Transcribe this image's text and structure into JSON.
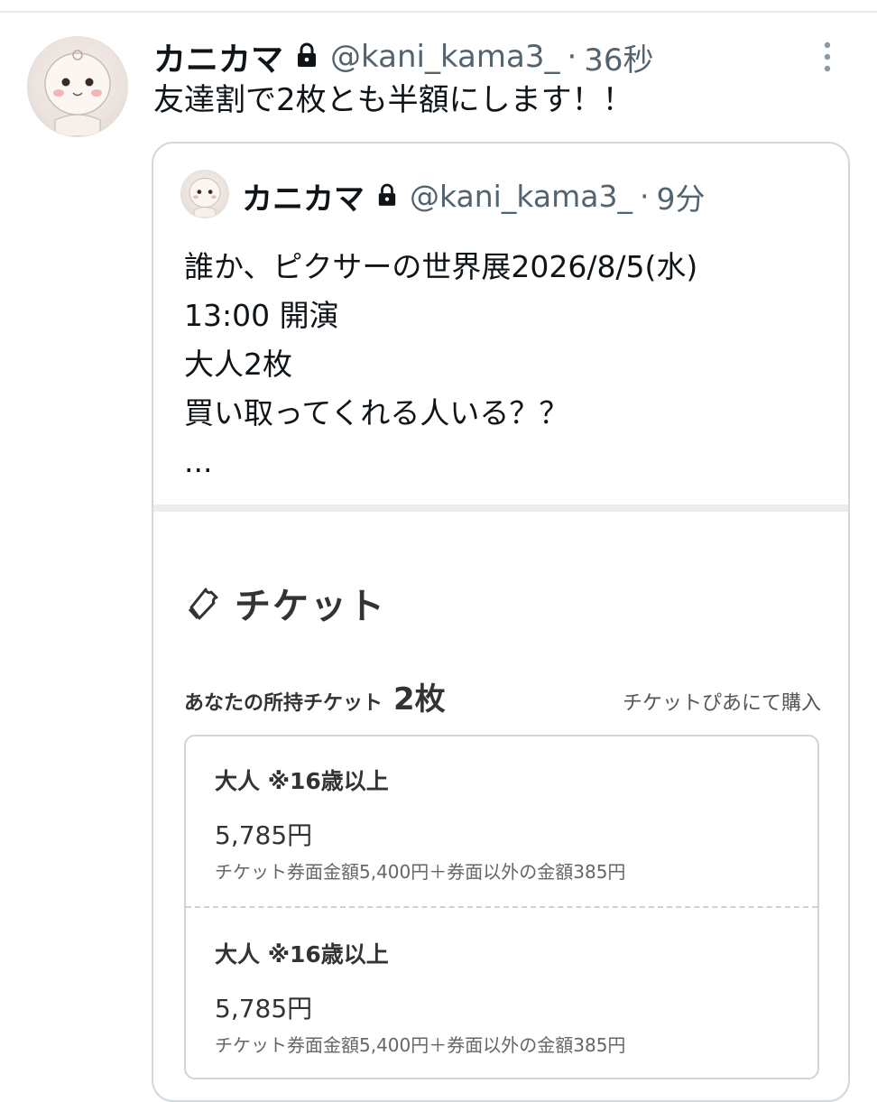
{
  "tweet": {
    "display_name": "カニカマ",
    "handle": "@kani_kama3_",
    "separator": "·",
    "time": "36秒",
    "text": "友達割で2枚とも半額にします！！"
  },
  "quoted": {
    "display_name": "カニカマ",
    "handle": "@kani_kama3_",
    "separator": "·",
    "time": "9分",
    "lines": [
      "誰か、ピクサーの世界展2026/8/5(水)",
      "13:00 開演",
      "大人2枚",
      "買い取ってくれる人いる？？",
      "..."
    ]
  },
  "ticket": {
    "title": "チケット",
    "owned_label": "あなたの所持チケット",
    "owned_count": "2枚",
    "purchase_link": "チケットぴあにて購入",
    "items": [
      {
        "type": "大人 ※16歳以上",
        "price": "5,785円",
        "detail": "チケット券面金額5,400円＋券面以外の金額385円"
      },
      {
        "type": "大人 ※16歳以上",
        "price": "5,785円",
        "detail": "チケット券面金額5,400円＋券面以外の金額385円"
      }
    ]
  },
  "icons": {
    "lock": "lock-icon",
    "more": "more-vertical-icon",
    "ticket": "ticket-icon"
  },
  "colors": {
    "secondary_text": "#536471",
    "border": "#cfd9de"
  }
}
